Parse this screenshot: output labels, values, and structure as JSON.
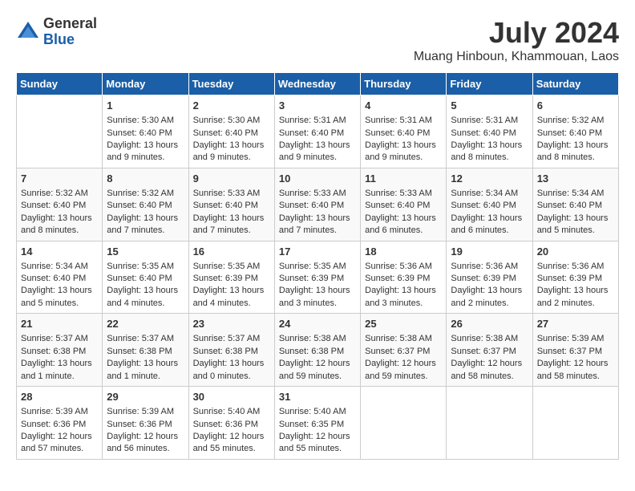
{
  "header": {
    "logo_general": "General",
    "logo_blue": "Blue",
    "month_title": "July 2024",
    "location": "Muang Hinboun, Khammouan, Laos"
  },
  "days_of_week": [
    "Sunday",
    "Monday",
    "Tuesday",
    "Wednesday",
    "Thursday",
    "Friday",
    "Saturday"
  ],
  "weeks": [
    [
      {
        "day": "",
        "content": ""
      },
      {
        "day": "1",
        "content": "Sunrise: 5:30 AM\nSunset: 6:40 PM\nDaylight: 13 hours\nand 9 minutes."
      },
      {
        "day": "2",
        "content": "Sunrise: 5:30 AM\nSunset: 6:40 PM\nDaylight: 13 hours\nand 9 minutes."
      },
      {
        "day": "3",
        "content": "Sunrise: 5:31 AM\nSunset: 6:40 PM\nDaylight: 13 hours\nand 9 minutes."
      },
      {
        "day": "4",
        "content": "Sunrise: 5:31 AM\nSunset: 6:40 PM\nDaylight: 13 hours\nand 9 minutes."
      },
      {
        "day": "5",
        "content": "Sunrise: 5:31 AM\nSunset: 6:40 PM\nDaylight: 13 hours\nand 8 minutes."
      },
      {
        "day": "6",
        "content": "Sunrise: 5:32 AM\nSunset: 6:40 PM\nDaylight: 13 hours\nand 8 minutes."
      }
    ],
    [
      {
        "day": "7",
        "content": "Sunrise: 5:32 AM\nSunset: 6:40 PM\nDaylight: 13 hours\nand 8 minutes."
      },
      {
        "day": "8",
        "content": "Sunrise: 5:32 AM\nSunset: 6:40 PM\nDaylight: 13 hours\nand 7 minutes."
      },
      {
        "day": "9",
        "content": "Sunrise: 5:33 AM\nSunset: 6:40 PM\nDaylight: 13 hours\nand 7 minutes."
      },
      {
        "day": "10",
        "content": "Sunrise: 5:33 AM\nSunset: 6:40 PM\nDaylight: 13 hours\nand 7 minutes."
      },
      {
        "day": "11",
        "content": "Sunrise: 5:33 AM\nSunset: 6:40 PM\nDaylight: 13 hours\nand 6 minutes."
      },
      {
        "day": "12",
        "content": "Sunrise: 5:34 AM\nSunset: 6:40 PM\nDaylight: 13 hours\nand 6 minutes."
      },
      {
        "day": "13",
        "content": "Sunrise: 5:34 AM\nSunset: 6:40 PM\nDaylight: 13 hours\nand 5 minutes."
      }
    ],
    [
      {
        "day": "14",
        "content": "Sunrise: 5:34 AM\nSunset: 6:40 PM\nDaylight: 13 hours\nand 5 minutes."
      },
      {
        "day": "15",
        "content": "Sunrise: 5:35 AM\nSunset: 6:40 PM\nDaylight: 13 hours\nand 4 minutes."
      },
      {
        "day": "16",
        "content": "Sunrise: 5:35 AM\nSunset: 6:39 PM\nDaylight: 13 hours\nand 4 minutes."
      },
      {
        "day": "17",
        "content": "Sunrise: 5:35 AM\nSunset: 6:39 PM\nDaylight: 13 hours\nand 3 minutes."
      },
      {
        "day": "18",
        "content": "Sunrise: 5:36 AM\nSunset: 6:39 PM\nDaylight: 13 hours\nand 3 minutes."
      },
      {
        "day": "19",
        "content": "Sunrise: 5:36 AM\nSunset: 6:39 PM\nDaylight: 13 hours\nand 2 minutes."
      },
      {
        "day": "20",
        "content": "Sunrise: 5:36 AM\nSunset: 6:39 PM\nDaylight: 13 hours\nand 2 minutes."
      }
    ],
    [
      {
        "day": "21",
        "content": "Sunrise: 5:37 AM\nSunset: 6:38 PM\nDaylight: 13 hours\nand 1 minute."
      },
      {
        "day": "22",
        "content": "Sunrise: 5:37 AM\nSunset: 6:38 PM\nDaylight: 13 hours\nand 1 minute."
      },
      {
        "day": "23",
        "content": "Sunrise: 5:37 AM\nSunset: 6:38 PM\nDaylight: 13 hours\nand 0 minutes."
      },
      {
        "day": "24",
        "content": "Sunrise: 5:38 AM\nSunset: 6:38 PM\nDaylight: 12 hours\nand 59 minutes."
      },
      {
        "day": "25",
        "content": "Sunrise: 5:38 AM\nSunset: 6:37 PM\nDaylight: 12 hours\nand 59 minutes."
      },
      {
        "day": "26",
        "content": "Sunrise: 5:38 AM\nSunset: 6:37 PM\nDaylight: 12 hours\nand 58 minutes."
      },
      {
        "day": "27",
        "content": "Sunrise: 5:39 AM\nSunset: 6:37 PM\nDaylight: 12 hours\nand 58 minutes."
      }
    ],
    [
      {
        "day": "28",
        "content": "Sunrise: 5:39 AM\nSunset: 6:36 PM\nDaylight: 12 hours\nand 57 minutes."
      },
      {
        "day": "29",
        "content": "Sunrise: 5:39 AM\nSunset: 6:36 PM\nDaylight: 12 hours\nand 56 minutes."
      },
      {
        "day": "30",
        "content": "Sunrise: 5:40 AM\nSunset: 6:36 PM\nDaylight: 12 hours\nand 55 minutes."
      },
      {
        "day": "31",
        "content": "Sunrise: 5:40 AM\nSunset: 6:35 PM\nDaylight: 12 hours\nand 55 minutes."
      },
      {
        "day": "",
        "content": ""
      },
      {
        "day": "",
        "content": ""
      },
      {
        "day": "",
        "content": ""
      }
    ]
  ]
}
